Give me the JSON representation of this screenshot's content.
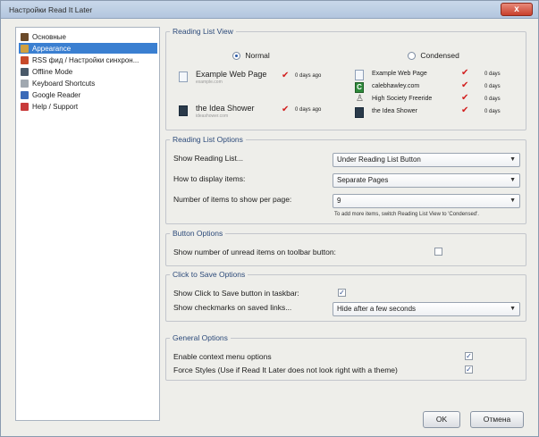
{
  "window": {
    "title": "Настройки Read It Later",
    "close_label": "x"
  },
  "sidebar": {
    "items": [
      {
        "label": "Основные",
        "icon": "general-icon",
        "color": "#6b4a2a"
      },
      {
        "label": "Appearance",
        "icon": "appearance-icon",
        "color": "#d0a040"
      },
      {
        "label": "RSS фид / Настройки синхрон...",
        "icon": "rss-sync-icon",
        "color": "#c84a2a"
      },
      {
        "label": "Offline Mode",
        "icon": "offline-icon",
        "color": "#4a5a6a"
      },
      {
        "label": "Keyboard Shortcuts",
        "icon": "keyboard-icon",
        "color": "#a0a8b0"
      },
      {
        "label": "Google Reader",
        "icon": "google-reader-icon",
        "color": "#3a6ab8"
      },
      {
        "label": "Help / Support",
        "icon": "help-icon",
        "color": "#c83a3a"
      }
    ],
    "selected_index": 1
  },
  "reading_list_view": {
    "title": "Reading List View",
    "normal_label": "Normal",
    "condensed_label": "Condensed",
    "selected": "normal",
    "normal_items": [
      {
        "title": "Example Web Page",
        "url": "example.com",
        "age": "0 days ago"
      },
      {
        "title": "the Idea Shower",
        "url": "ideashower.com",
        "age": "0 days ago"
      }
    ],
    "condensed_items": [
      {
        "title": "Example Web Page",
        "age": "0 days"
      },
      {
        "title": "calebhawley.com",
        "age": "0 days"
      },
      {
        "title": "High Society Freeride",
        "age": "0 days"
      },
      {
        "title": "the Idea Shower",
        "age": "0 days"
      }
    ]
  },
  "reading_list_options": {
    "title": "Reading List Options",
    "show_label": "Show Reading List...",
    "show_value": "Under Reading List Button",
    "display_label": "How to display items:",
    "display_value": "Separate Pages",
    "per_page_label": "Number of items to show per page:",
    "per_page_value": "9",
    "hint": "To add more items, switch Reading List View to 'Condensed'."
  },
  "button_options": {
    "title": "Button Options",
    "unread_label": "Show number of unread items on toolbar button:",
    "unread_checked": false
  },
  "click_to_save": {
    "title": "Click to Save Options",
    "taskbar_label": "Show Click to Save button in taskbar:",
    "taskbar_checked": true,
    "checkmarks_label": "Show checkmarks on saved links...",
    "checkmarks_value": "Hide after a few seconds"
  },
  "general_options": {
    "title": "General Options",
    "context_label": "Enable context menu options",
    "context_checked": true,
    "force_label": "Force Styles (Use if Read It Later does not look right with a theme)",
    "force_checked": true
  },
  "footer": {
    "ok_label": "OK",
    "cancel_label": "Отмена"
  },
  "colors": {
    "accent": "#3a7fd1",
    "group_title": "#2c4a7a",
    "check_red": "#d21f1f"
  }
}
